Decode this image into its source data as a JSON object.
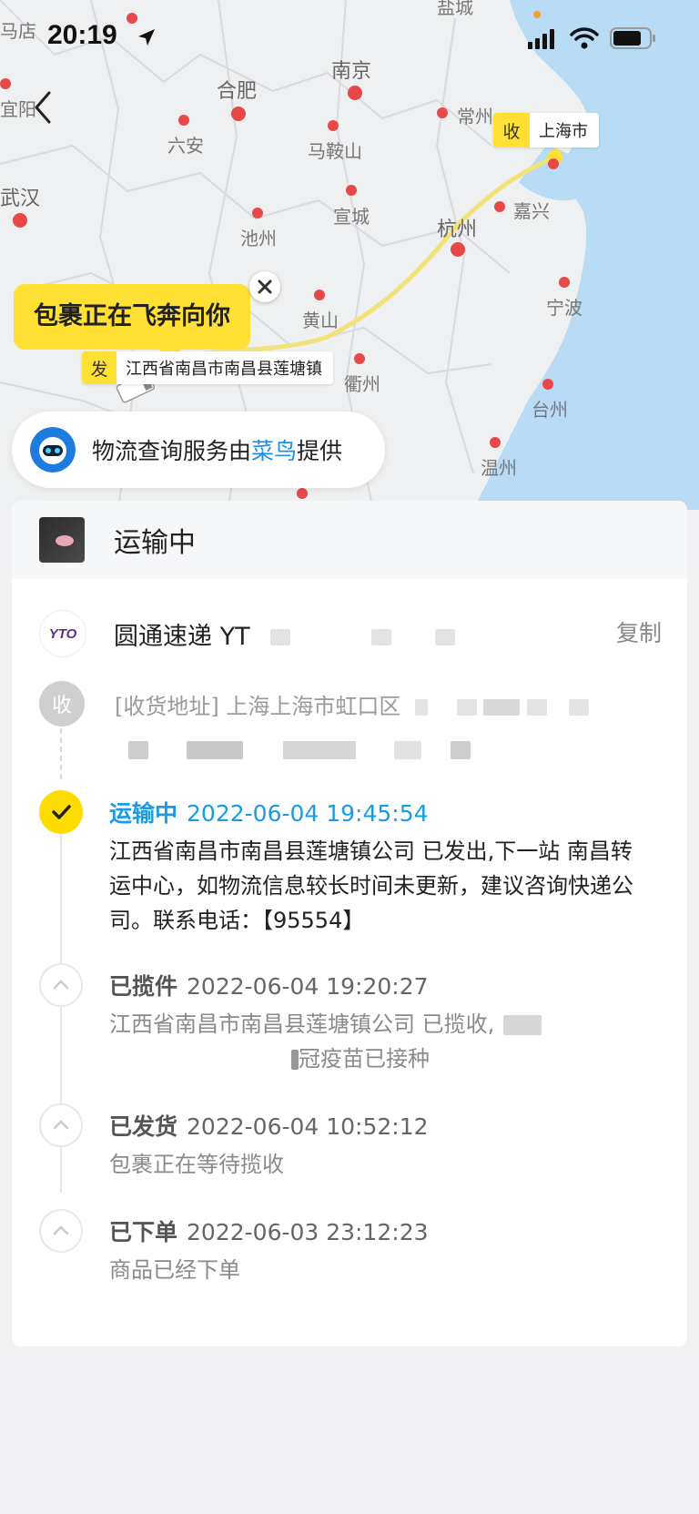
{
  "status_bar": {
    "time": "20:19"
  },
  "map": {
    "bubble_text": "包裹正在飞奔向你",
    "origin": {
      "badge": "发",
      "label": "江西省南昌市南昌县莲塘镇"
    },
    "destination": {
      "badge": "收",
      "label": "上海市"
    },
    "cities": [
      {
        "name": "马店"
      },
      {
        "name": "南京"
      },
      {
        "name": "合肥"
      },
      {
        "name": "常州"
      },
      {
        "name": "宜阳"
      },
      {
        "name": "六安"
      },
      {
        "name": "马鞍山"
      },
      {
        "name": "武汉"
      },
      {
        "name": "宣城"
      },
      {
        "name": "嘉兴"
      },
      {
        "name": "池州"
      },
      {
        "name": "杭州"
      },
      {
        "name": "宁波"
      },
      {
        "name": "黄山"
      },
      {
        "name": "衢州"
      },
      {
        "name": "台州"
      },
      {
        "name": "温州"
      },
      {
        "name": "盐城"
      }
    ],
    "provider": {
      "prefix": "物流查询服务由",
      "highlight": "菜鸟",
      "suffix": "提供"
    }
  },
  "shipment": {
    "status": "运输中",
    "carrier": {
      "logo_text": "YTO",
      "name": "圆通速递 YT",
      "copy_label": "复制"
    },
    "address": {
      "icon": "收",
      "text": "[收货地址] 上海上海市虹口区"
    },
    "events": [
      {
        "title": "运输中",
        "time": "2022-06-04 19:45:54",
        "body": "江西省南昌市南昌县莲塘镇公司 已发出,下一站 南昌转运中心，如物流信息较长时间未更新，建议咨询快递公司。联系电话：【95554】"
      },
      {
        "title": "已揽件",
        "time": "2022-06-04 19:20:27",
        "body": "江西省南昌市南昌县莲塘镇公司 已揽收,",
        "body2": "冠疫苗已接种"
      },
      {
        "title": "已发货",
        "time": "2022-06-04 10:52:12",
        "body": "包裹正在等待揽收"
      },
      {
        "title": "已下单",
        "time": "2022-06-03 23:12:23",
        "body": "商品已经下单"
      }
    ]
  },
  "colors": {
    "accent_yellow": "#ffdc00",
    "link_blue": "#1a9be6"
  }
}
